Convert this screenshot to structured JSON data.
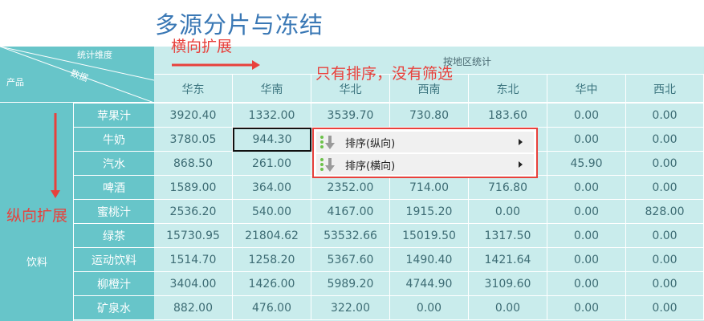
{
  "title": "多源分片与冻结",
  "annotations": {
    "horizontal": "横向扩展",
    "vertical": "纵向扩展",
    "note": "只有排序，没有筛选"
  },
  "corner": {
    "stat_dim": "统计维度",
    "data": "数据",
    "product": "产品"
  },
  "group_header": "按地区统计",
  "columns": [
    "华东",
    "华南",
    "华北",
    "西南",
    "东北",
    "华中",
    "西北"
  ],
  "category": "饮料",
  "rows": [
    {
      "name": "苹果汁",
      "values": [
        "3920.40",
        "1332.00",
        "3539.70",
        "730.80",
        "183.60",
        "0.00",
        "0.00"
      ]
    },
    {
      "name": "牛奶",
      "values": [
        "3780.05",
        "944.30",
        "",
        "",
        "",
        "0.00",
        "0.00"
      ]
    },
    {
      "name": "汽水",
      "values": [
        "868.50",
        "261.00",
        "",
        "",
        "",
        "45.90",
        "0.00"
      ]
    },
    {
      "name": "啤酒",
      "values": [
        "1589.00",
        "364.00",
        "2352.00",
        "714.00",
        "716.80",
        "0.00",
        "0.00"
      ]
    },
    {
      "name": "蜜桃汁",
      "values": [
        "2536.20",
        "540.00",
        "4167.00",
        "1915.20",
        "0.00",
        "0.00",
        "828.00"
      ]
    },
    {
      "name": "绿茶",
      "values": [
        "15730.95",
        "21804.62",
        "53532.66",
        "15019.50",
        "1317.50",
        "0.00",
        "0.00"
      ]
    },
    {
      "name": "运动饮料",
      "values": [
        "1514.70",
        "1258.20",
        "5367.60",
        "1490.40",
        "1421.64",
        "0.00",
        "0.00"
      ]
    },
    {
      "name": "柳橙汁",
      "values": [
        "3404.00",
        "1426.00",
        "5989.20",
        "4744.90",
        "3109.60",
        "0.00",
        "0.00"
      ]
    },
    {
      "name": "矿泉水",
      "values": [
        "882.00",
        "476.00",
        "322.00",
        "0.00",
        "0.00",
        "0.00",
        "0.00"
      ]
    }
  ],
  "context_menu": [
    {
      "label": "排序(纵向)"
    },
    {
      "label": "排序(横向)"
    }
  ],
  "colors": {
    "title": "#3a78b5",
    "annotation": "#e8413c",
    "header_dark": "#67c5c9",
    "cell_bg": "#c9ecec"
  }
}
